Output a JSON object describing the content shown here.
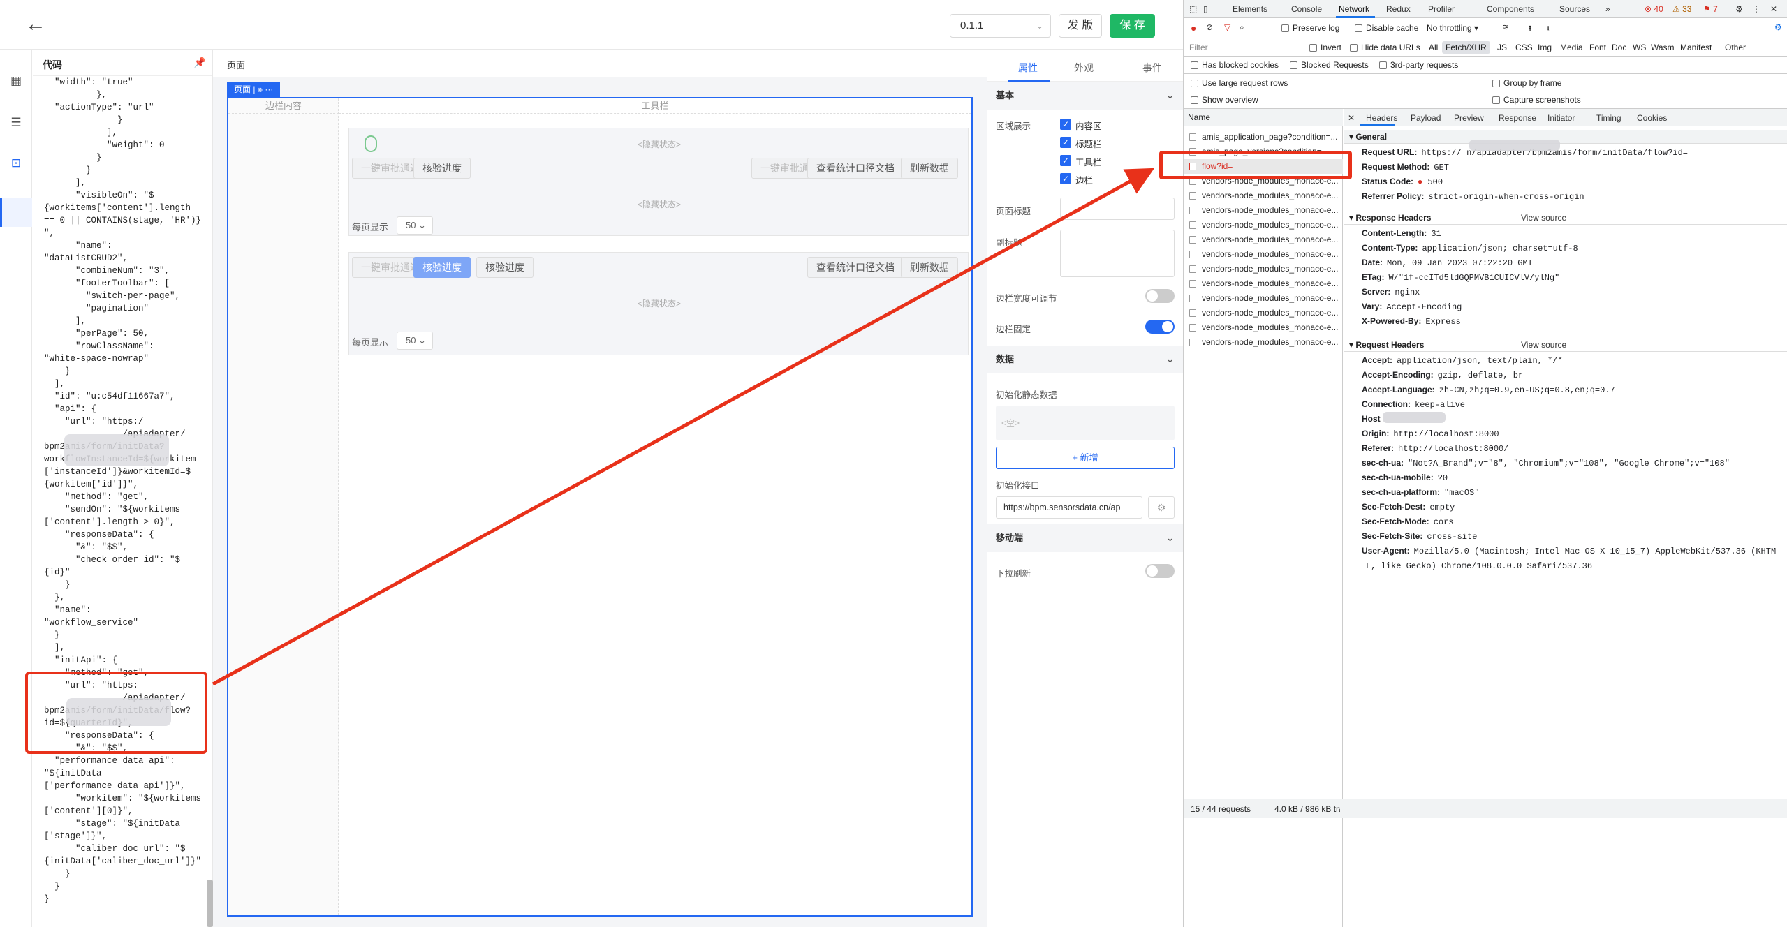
{
  "editor": {
    "version": "0.1.1",
    "publish": "发 版",
    "save": "保 存",
    "code_title": "代码",
    "canvas_title": "页面",
    "page_tag": "页面 | ⚹ ···",
    "aside_label": "边栏内容",
    "toolbar_label": "工具栏",
    "hidden_state": "<隐藏状态>",
    "per_page_label": "每页显示",
    "per_page_value": "50",
    "crud1_buttons_left": [
      "一键审批通过",
      "核验进度"
    ],
    "crud1_buttons_right": [
      "一键审批通过",
      "查看统计口径文档",
      "刷新数据"
    ],
    "crud2_buttons_left": [
      "一键审批通过",
      "核验进度",
      "核验进度"
    ],
    "crud2_buttons_right": [
      "查看统计口径文档",
      "刷新数据"
    ],
    "code_lines": [
      "  \"width\": \"true\"",
      "          },",
      "  \"actionType\": \"url\"",
      "              }",
      "            ],",
      "            \"weight\": 0",
      "          }",
      "        }",
      "      ],",
      "      \"visibleOn\": \"$",
      "{workitems['content'].length",
      "== 0 || CONTAINS(stage, 'HR')}",
      "\",",
      "      \"name\":",
      "\"dataListCRUD2\",",
      "      \"combineNum\": \"3\",",
      "      \"footerToolbar\": [",
      "        \"switch-per-page\",",
      "        \"pagination\"",
      "      ],",
      "      \"perPage\": 50,",
      "      \"rowClassName\":",
      "\"white-space-nowrap\"",
      "    }",
      "  ],",
      "  \"id\": \"u:c54df11667a7\",",
      "  \"api\": {",
      "    \"url\": \"https:/",
      "               /apiadapter/",
      "bpm2amis/form/initData?",
      "workflowInstanceId=${workitem",
      "['instanceId']}&workitemId=$",
      "{workitem['id']}\",",
      "    \"method\": \"get\",",
      "    \"sendOn\": \"${workitems",
      "['content'].length > 0}\",",
      "    \"responseData\": {",
      "      \"&\": \"$$\",",
      "      \"check_order_id\": \"$",
      "{id}\"",
      "    }",
      "  },",
      "  \"name\":",
      "\"workflow_service\"",
      "  }",
      "  ],",
      "  \"initApi\": {",
      "    \"method\": \"get\",",
      "    \"url\": \"https:",
      "               /apiadapter/",
      "bpm2amis/form/initData/flow?",
      "id=${quarterId}\",",
      "    \"responseData\": {",
      "      \"&\": \"$$\",",
      "  \"performance_data_api\":",
      "\"${initData",
      "['performance_data_api']}\",",
      "      \"workitem\": \"${workitems",
      "['content'][0]}\",",
      "      \"stage\": \"${initData",
      "['stage']}\",",
      "      \"caliber_doc_url\": \"$",
      "{initData['caliber_doc_url']}\"",
      "    }",
      "  }",
      "}"
    ]
  },
  "props": {
    "tabs": [
      "属性",
      "外观",
      "事件"
    ],
    "section_basic": "基本",
    "region_label": "区域展示",
    "regions": [
      "内容区",
      "标题栏",
      "工具栏",
      "边栏"
    ],
    "page_title_label": "页面标题",
    "subtitle_label": "副标题",
    "aside_resizable_label": "边栏宽度可调节",
    "aside_fixed_label": "边栏固定",
    "section_data": "数据",
    "static_data_label": "初始化静态数据",
    "static_data_placeholder": "<空>",
    "add_button": "+ 新增",
    "init_api_label": "初始化接口",
    "init_api_value": "https://bpm.sensorsdata.cn/ap",
    "section_mobile": "移动端",
    "pull_refresh_label": "下拉刷新"
  },
  "devtools": {
    "tabs": [
      "Elements",
      "Console",
      "Network",
      "Redux",
      "Profiler",
      "Components",
      "Sources",
      "»"
    ],
    "errors": "40",
    "warnings": "33",
    "issues": "7",
    "toolbar": {
      "preserve_log": "Preserve log",
      "disable_cache": "Disable cache",
      "throttling": "No throttling"
    },
    "filter_placeholder": "Filter",
    "invert": "Invert",
    "hide_data_urls": "Hide data URLs",
    "type_filters": [
      "All",
      "Fetch/XHR",
      "JS",
      "CSS",
      "Img",
      "Media",
      "Font",
      "Doc",
      "WS",
      "Wasm",
      "Manifest",
      "Other"
    ],
    "has_blocked_cookies": "Has blocked cookies",
    "blocked_requests": "Blocked Requests",
    "third_party": "3rd-party requests",
    "use_large_rows": "Use large request rows",
    "group_by_frame": "Group by frame",
    "show_overview": "Show overview",
    "capture_screenshots": "Capture screenshots",
    "name_col": "Name",
    "requests": [
      "amis_application_page?condition=...",
      "amis_page_versions?condition=...",
      "flow?id=",
      "vendors-node_modules_monaco-e...",
      "vendors-node_modules_monaco-e...",
      "vendors-node_modules_monaco-e...",
      "vendors-node_modules_monaco-e...",
      "vendors-node_modules_monaco-e...",
      "vendors-node_modules_monaco-e...",
      "vendors-node_modules_monaco-e...",
      "vendors-node_modules_monaco-e...",
      "vendors-node_modules_monaco-e...",
      "vendors-node_modules_monaco-e...",
      "vendors-node_modules_monaco-e...",
      "vendors-node_modules_monaco-e..."
    ],
    "footer_requests": "15 / 44 requests",
    "footer_transfer": "4.0 kB / 986 kB trans",
    "detail_tabs": [
      "Headers",
      "Payload",
      "Preview",
      "Response",
      "Initiator",
      "Timing",
      "Cookies"
    ],
    "general_title": "General",
    "general": [
      {
        "k": "Request URL:",
        "v": "https://                          n/apiadapter/bpm2amis/form/initData/flow?id="
      },
      {
        "k": "Request Method:",
        "v": "GET"
      },
      {
        "k": "Status Code:",
        "v": "● 500"
      },
      {
        "k": "Referrer Policy:",
        "v": "strict-origin-when-cross-origin"
      }
    ],
    "response_headers_title": "Response Headers",
    "view_source": "View source",
    "response_headers": [
      {
        "k": "Content-Length:",
        "v": "31"
      },
      {
        "k": "Content-Type:",
        "v": "application/json; charset=utf-8"
      },
      {
        "k": "Date:",
        "v": "Mon, 09 Jan 2023 07:22:20 GMT"
      },
      {
        "k": "ETag:",
        "v": "W/\"1f-ccITd5ldGQPMVB1CUICVlV/ylNg\""
      },
      {
        "k": "Server:",
        "v": "nginx"
      },
      {
        "k": "Vary:",
        "v": "Accept-Encoding"
      },
      {
        "k": "X-Powered-By:",
        "v": "Express"
      }
    ],
    "request_headers_title": "Request Headers",
    "request_headers": [
      {
        "k": "Accept:",
        "v": "application/json, text/plain, */*"
      },
      {
        "k": "Accept-Encoding:",
        "v": "gzip, deflate, br"
      },
      {
        "k": "Accept-Language:",
        "v": "zh-CN,zh;q=0.9,en-US;q=0.8,en;q=0.7"
      },
      {
        "k": "Connection:",
        "v": "keep-alive"
      },
      {
        "k": "Host",
        "v": ""
      },
      {
        "k": "Origin:",
        "v": "http://localhost:8000"
      },
      {
        "k": "Referer:",
        "v": "http://localhost:8000/"
      },
      {
        "k": "sec-ch-ua:",
        "v": "\"Not?A_Brand\";v=\"8\", \"Chromium\";v=\"108\", \"Google Chrome\";v=\"108\""
      },
      {
        "k": "sec-ch-ua-mobile:",
        "v": "?0"
      },
      {
        "k": "sec-ch-ua-platform:",
        "v": "\"macOS\""
      },
      {
        "k": "Sec-Fetch-Dest:",
        "v": "empty"
      },
      {
        "k": "Sec-Fetch-Mode:",
        "v": "cors"
      },
      {
        "k": "Sec-Fetch-Site:",
        "v": "cross-site"
      },
      {
        "k": "User-Agent:",
        "v": "Mozilla/5.0 (Macintosh; Intel Mac OS X 10_15_7) AppleWebKit/537.36 (KHTM"
      },
      {
        "k": "",
        "v": "L, like Gecko) Chrome/108.0.0.0 Safari/537.36"
      }
    ]
  },
  "colors": {
    "accent": "#2468f2",
    "save_green": "#1fb865",
    "annotation_red": "#e8311a",
    "error_red": "#d93025"
  }
}
